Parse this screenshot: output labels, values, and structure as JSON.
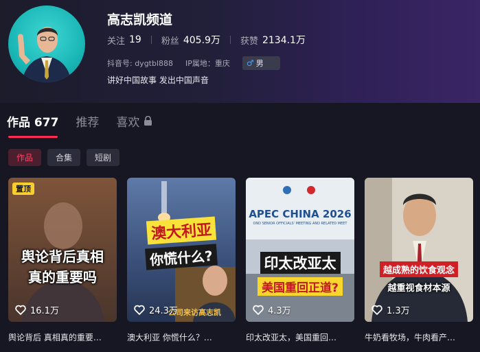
{
  "profile": {
    "name": "高志凯频道",
    "stats": [
      {
        "label": "关注",
        "value": "19"
      },
      {
        "label": "粉丝",
        "value": "405.9万"
      },
      {
        "label": "获赞",
        "value": "2134.1万"
      }
    ],
    "douyin_id": "抖音号: dygtbl888",
    "ip": "IP属地：重庆",
    "gender_symbol": "♂",
    "gender": "男",
    "bio": "讲好中国故事 发出中国声音"
  },
  "tabs": [
    {
      "label": "作品 677",
      "active": true
    },
    {
      "label": "推荐",
      "active": false
    },
    {
      "label": "喜欢",
      "active": false
    }
  ],
  "chips": [
    {
      "label": "作品",
      "active": true
    },
    {
      "label": "合集",
      "active": false
    },
    {
      "label": "短剧",
      "active": false
    }
  ],
  "videos": [
    {
      "pinned_label": "置顶",
      "overlay_lines": [
        "舆论背后真相",
        "真的重要吗"
      ],
      "likes": "16.1万",
      "caption": "舆论背后 真相真的重要…"
    },
    {
      "overlay_lines": [
        "澳大利亚",
        "你慌什么?"
      ],
      "likes": "24.3万",
      "sub_overlay": "公司来访高志凯",
      "caption": "澳大利亚 你慌什么？…"
    },
    {
      "banner_title": "APEC CHINA 2026",
      "banner_sub": "OND SENIOR OFFICIALS' MEETING AND RELATED MEET",
      "overlay_lines": [
        "印太改亚太",
        "美国重回正道?"
      ],
      "likes": "4.3万",
      "caption": "印太改亚太，美国重回…"
    },
    {
      "overlay_lines": [
        "越成熟的饮食观念",
        "越重视食材本源"
      ],
      "likes": "1.3万",
      "caption": "牛奶看牧场，牛肉看产…"
    }
  ],
  "colors": {
    "accent": "#fe2c55",
    "pin": "#f9cf2e",
    "bg": "#161722"
  }
}
